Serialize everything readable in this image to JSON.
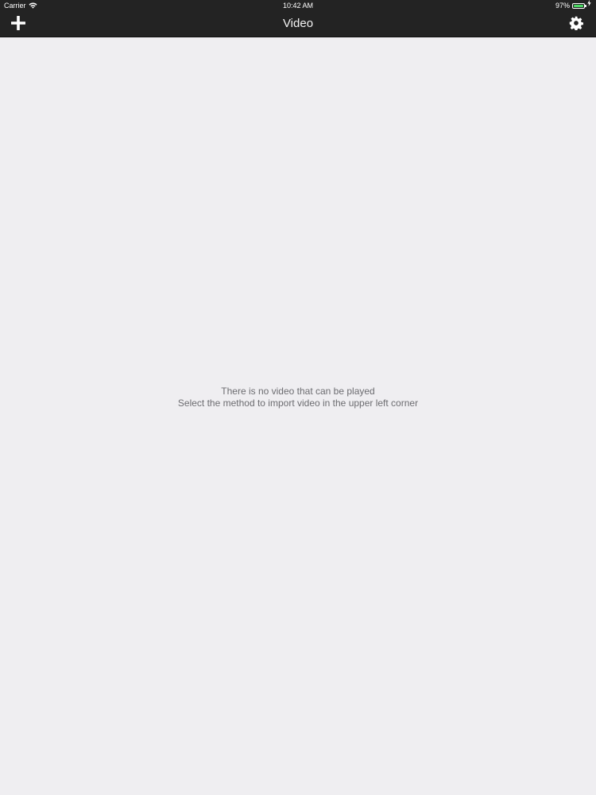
{
  "status_bar": {
    "carrier": "Carrier",
    "time": "10:42 AM",
    "battery_percent": "97%",
    "battery_level": 0.97,
    "battery_color": "#4cd964",
    "wifi_icon": "wifi-icon",
    "charging_icon": "charging-icon"
  },
  "nav_bar": {
    "title": "Video",
    "left_icon": "plus-icon",
    "right_icon": "gear-icon",
    "background": "#232323"
  },
  "empty_state": {
    "line1": "There is no video that can be played",
    "line2": "Select the method to import video in the upper left corner"
  }
}
